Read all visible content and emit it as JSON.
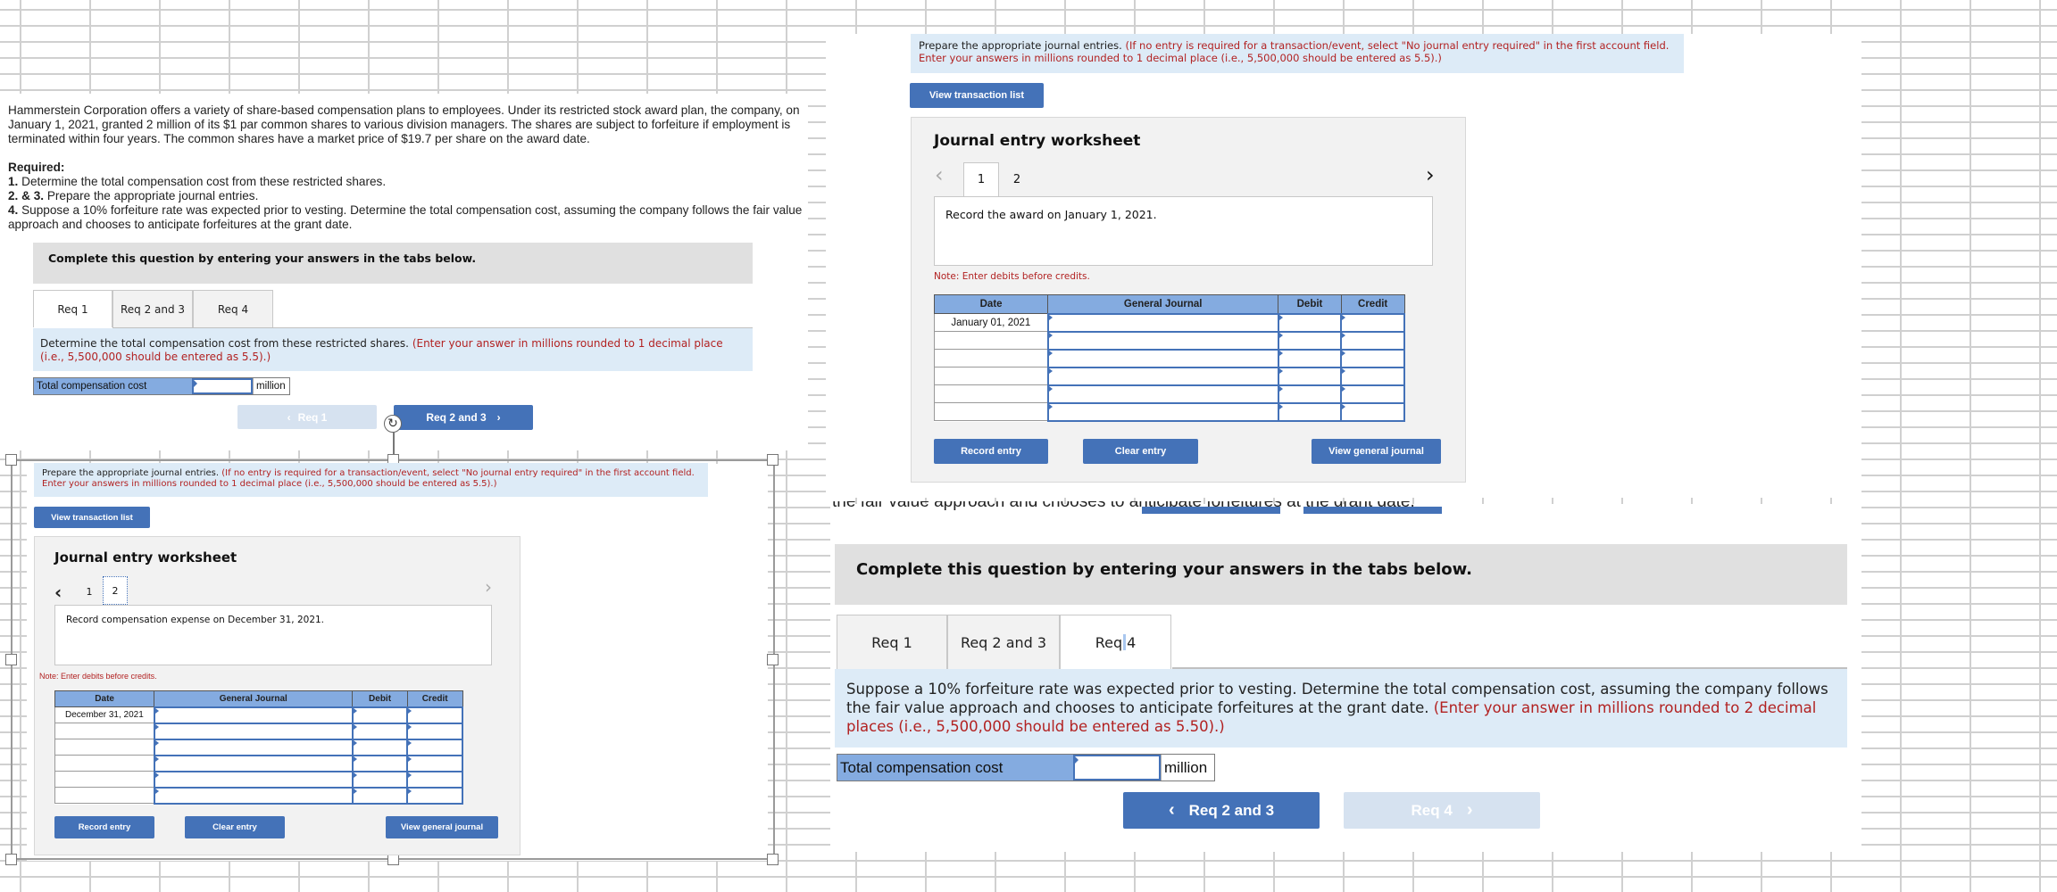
{
  "problem": {
    "intro": "Hammerstein Corporation offers a variety of share-based compensation plans to employees. Under its restricted stock award plan, the company, on January 1, 2021, granted 2 million of its $1 par common shares to various division managers. The shares are subject to forfeiture if employment is terminated within four years. The common shares have a market price of $19.7 per share on the award date.",
    "required_label": "Required:",
    "requirements": [
      {
        "num": "1.",
        "text": " Determine the total compensation cost from these restricted shares."
      },
      {
        "num": "2. & 3.",
        "text": " Prepare the appropriate journal entries."
      },
      {
        "num": "4.",
        "text": " Suppose a 10% forfeiture rate was expected prior to vesting. Determine the total compensation cost, assuming the company follows the fair value approach and chooses to anticipate forfeitures at the grant date."
      }
    ],
    "overlap_fragment": "the fair value approach and chooses to anticipate forfeitures at the grant date."
  },
  "panel_left": {
    "complete_bar": "Complete this question by entering your answers in the tabs below.",
    "tabs": [
      {
        "label": "Req 1",
        "active": true
      },
      {
        "label": "Req 2 and 3",
        "active": false
      },
      {
        "label": "Req 4",
        "active": false
      }
    ],
    "instruction": "Determine the total compensation cost from these restricted shares.",
    "instruction_red": "(Enter your answer in millions rounded to 1 decimal place (i.e., 5,500,000 should be entered as 5.5).)",
    "answer_label": "Total compensation cost",
    "answer_value": "",
    "answer_unit": "million",
    "prev_button": "Req 1",
    "next_button": "Req 2 and 3"
  },
  "journal_left": {
    "instruction": "Prepare the appropriate journal entries.",
    "instruction_red": "(If no entry is required for a transaction/event, select \"No journal entry required\" in the first account field. Enter your answers in millions rounded to 1 decimal place (i.e., 5,500,000 should be entered as 5.5).)",
    "view_transaction_list": "View transaction list",
    "worksheet_title": "Journal entry worksheet",
    "pages": [
      "1",
      "2"
    ],
    "active_page": "2",
    "description": "Record compensation expense on December 31, 2021.",
    "note": "Note: Enter debits before credits.",
    "columns": [
      "Date",
      "General Journal",
      "Debit",
      "Credit"
    ],
    "rows": [
      {
        "date": "December 31, 2021",
        "account": "",
        "debit": "",
        "credit": ""
      },
      {
        "date": "",
        "account": "",
        "debit": "",
        "credit": ""
      },
      {
        "date": "",
        "account": "",
        "debit": "",
        "credit": ""
      },
      {
        "date": "",
        "account": "",
        "debit": "",
        "credit": ""
      },
      {
        "date": "",
        "account": "",
        "debit": "",
        "credit": ""
      },
      {
        "date": "",
        "account": "",
        "debit": "",
        "credit": ""
      }
    ],
    "record_entry": "Record entry",
    "clear_entry": "Clear entry",
    "view_general_journal": "View general journal"
  },
  "journal_right": {
    "instruction": "Prepare the appropriate journal entries.",
    "instruction_red": "(If no entry is required for a transaction/event, select \"No journal entry required\" in the first account field. Enter your answers in millions rounded to 1 decimal place (i.e., 5,500,000 should be entered as 5.5).)",
    "view_transaction_list": "View transaction list",
    "worksheet_title": "Journal entry worksheet",
    "pages": [
      "1",
      "2"
    ],
    "active_page": "1",
    "description": "Record the award on January 1, 2021.",
    "note": "Note: Enter debits before credits.",
    "columns": [
      "Date",
      "General Journal",
      "Debit",
      "Credit"
    ],
    "rows": [
      {
        "date": "January 01, 2021",
        "account": "",
        "debit": "",
        "credit": ""
      },
      {
        "date": "",
        "account": "",
        "debit": "",
        "credit": ""
      },
      {
        "date": "",
        "account": "",
        "debit": "",
        "credit": ""
      },
      {
        "date": "",
        "account": "",
        "debit": "",
        "credit": ""
      },
      {
        "date": "",
        "account": "",
        "debit": "",
        "credit": ""
      },
      {
        "date": "",
        "account": "",
        "debit": "",
        "credit": ""
      }
    ],
    "record_entry": "Record entry",
    "clear_entry": "Clear entry",
    "view_general_journal": "View general journal"
  },
  "panel_right": {
    "complete_bar": "Complete this question by entering your answers in the tabs below.",
    "tabs": [
      {
        "label": "Req 1",
        "active": false
      },
      {
        "label": "Req 2 and 3",
        "active": false
      },
      {
        "label_a": "Req",
        "label_b": "4",
        "active": true
      }
    ],
    "instruction": "Suppose a 10% forfeiture rate was expected prior to vesting. Determine the total compensation cost, assuming the company follows the fair value approach and chooses to anticipate forfeitures at the grant date.",
    "instruction_red": "(Enter your answer in millions rounded to 2 decimal places (i.e., 5,500,000 should be entered as 5.50).)",
    "answer_label": "Total compensation cost",
    "answer_value": "",
    "answer_unit": "million",
    "prev_button": "Req 2 and 3",
    "next_button": "Req 4"
  },
  "icons": {
    "chevron_left": "‹",
    "chevron_right": "›",
    "refresh": "↻"
  }
}
